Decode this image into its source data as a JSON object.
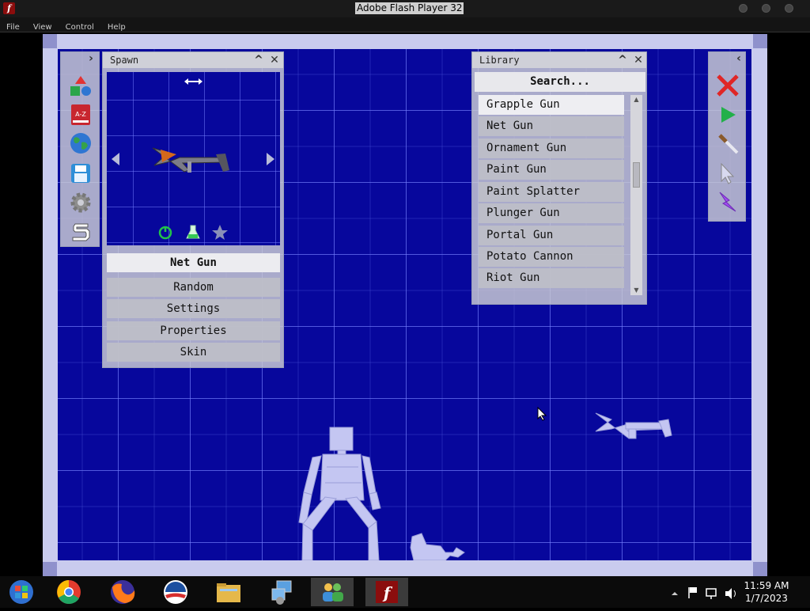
{
  "window": {
    "title": "Adobe Flash Player 32"
  },
  "menu": [
    "File",
    "View",
    "Control",
    "Help"
  ],
  "spawn": {
    "title": "Spawn",
    "selected_item": "Net Gun",
    "buttons": [
      "Random",
      "Settings",
      "Properties",
      "Skin"
    ]
  },
  "library": {
    "title": "Library",
    "search_label": "Search...",
    "items": [
      "Grapple Gun",
      "Net Gun",
      "Ornament Gun",
      "Paint Gun",
      "Paint Splatter",
      "Plunger Gun",
      "Portal Gun",
      "Potato Cannon",
      "Riot Gun"
    ],
    "selected": "Grapple Gun"
  },
  "left_toolbar": {
    "icons": [
      "shapes-icon",
      "dictionary-icon",
      "globe-icon",
      "save-disk-icon",
      "gear-icon",
      "s-logo-icon"
    ],
    "a_z_label": "A-Z"
  },
  "right_toolbar": {
    "icons": [
      "close-x-icon",
      "play-icon",
      "knife-icon",
      "pointer-icon",
      "lightning-icon"
    ]
  },
  "taskbar": {
    "apps": [
      "windows-start-icon",
      "chrome-icon",
      "firefox-icon",
      "obama-logo-icon",
      "file-explorer-icon",
      "network-settings-icon",
      "people-icon",
      "flash-player-icon"
    ],
    "time": "11:59 AM",
    "date": "1/7/2023"
  },
  "colors": {
    "stage": "#07079c",
    "grid": "#7882ff",
    "panel": "#cdced6",
    "title_bar": "#1a1a1a"
  }
}
